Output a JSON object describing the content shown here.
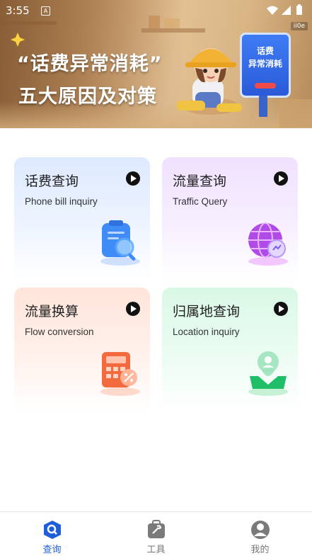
{
  "status_bar": {
    "time": "3:55",
    "notification_icon": "A"
  },
  "banner": {
    "ad_tag": "ii0e",
    "headline_line1": "“话费异常消耗”",
    "headline_line2": "五大原因及对策",
    "sign_line1": "话费",
    "sign_line2": "异常消耗"
  },
  "cards": [
    {
      "title": "话费查询",
      "subtitle": "Phone bill inquiry",
      "icon": "phone-bill-search-icon"
    },
    {
      "title": "流量查询",
      "subtitle": "Traffic Query",
      "icon": "globe-traffic-icon"
    },
    {
      "title": "流量换算",
      "subtitle": "Flow conversion",
      "icon": "calculator-icon"
    },
    {
      "title": "归属地查询",
      "subtitle": "Location inquiry",
      "icon": "location-pin-icon"
    }
  ],
  "bottom_nav": [
    {
      "label": "查询",
      "icon": "search-icon",
      "active": true
    },
    {
      "label": "工具",
      "icon": "toolbox-icon",
      "active": false
    },
    {
      "label": "我的",
      "icon": "profile-icon",
      "active": false
    }
  ],
  "colors": {
    "accent": "#1f5ed8",
    "inactive": "#777777"
  }
}
